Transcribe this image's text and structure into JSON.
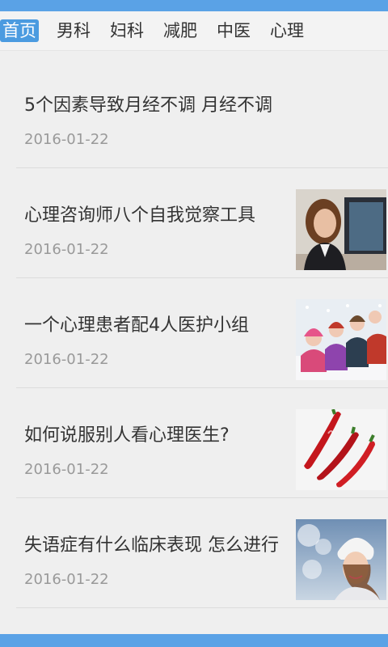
{
  "tabs": [
    "首页",
    "男科",
    "妇科",
    "减肥",
    "中医",
    "心理"
  ],
  "articles": [
    {
      "title": "5个因素导致月经不调 月经不调",
      "date": "2016-01-22",
      "thumb": "none"
    },
    {
      "title": "心理咨询师八个自我觉察工具",
      "date": "2016-01-22",
      "thumb": "woman-at-computer"
    },
    {
      "title": "一个心理患者配4人医护小组",
      "date": "2016-01-22",
      "thumb": "children-in-snow"
    },
    {
      "title": "如何说服别人看心理医生?",
      "date": "2016-01-22",
      "thumb": "red-chili-peppers"
    },
    {
      "title": "失语症有什么临床表现 怎么进行",
      "date": "2016-01-22",
      "thumb": "woman-in-winter-hat"
    }
  ]
}
